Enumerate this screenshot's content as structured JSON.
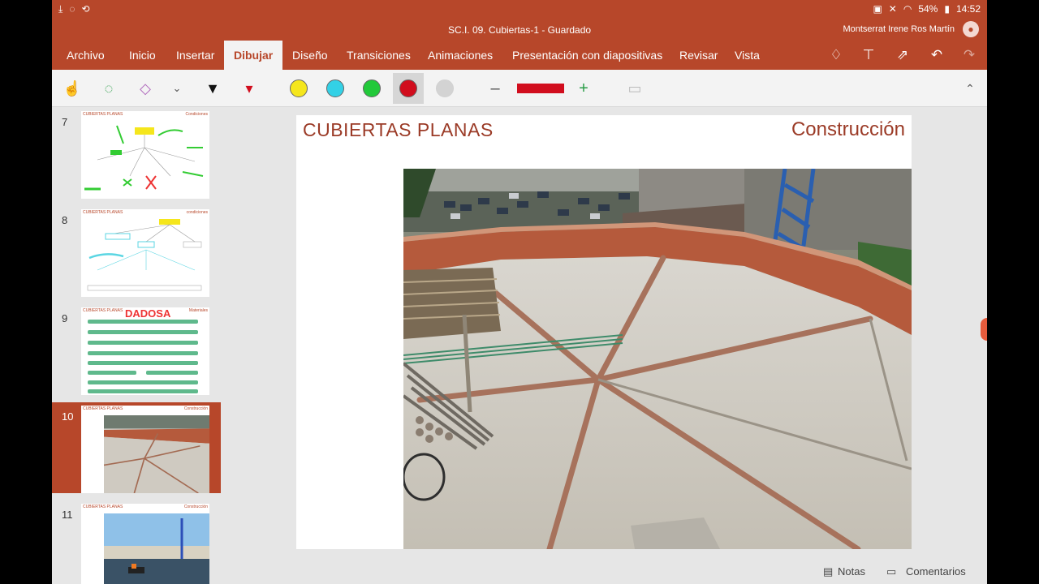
{
  "status": {
    "battery": "54%",
    "time": "14:52"
  },
  "window": {
    "title": "SC.I. 09. Cubiertas-1 - Guardado",
    "user": "Montserrat Irene Ros Martín"
  },
  "tabs": [
    {
      "label": "Archivo"
    },
    {
      "label": "Inicio"
    },
    {
      "label": "Insertar"
    },
    {
      "label": "Dibujar",
      "active": true
    },
    {
      "label": "Diseño"
    },
    {
      "label": "Transiciones"
    },
    {
      "label": "Animaciones"
    },
    {
      "label": "Presentación con diapositivas"
    },
    {
      "label": "Revisar"
    },
    {
      "label": "Vista"
    }
  ],
  "toolbar": {
    "icons": [
      "touch-draw-icon",
      "lasso-select-icon",
      "eraser-icon",
      "chevron-down-icon",
      "pen-icon",
      "highlighter-icon"
    ],
    "colors": [
      "#f5e61c",
      "#33d1e6",
      "#22c93a",
      "#d10d1d",
      "#bfbfbf"
    ],
    "selected_color": "#d10d1d",
    "stroke_minus": "–",
    "stroke_plus": "+"
  },
  "thumbnails": [
    {
      "number": "7",
      "header": "CUBIERTAS PLANAS",
      "tag": "Condiciones"
    },
    {
      "number": "8",
      "header": "CUBIERTAS PLANAS",
      "tag": "condiciones"
    },
    {
      "number": "9",
      "header": "CUBIERTAS PLANAS",
      "tag": "Materiales",
      "annotation": "DADOSA"
    },
    {
      "number": "10",
      "header": "CUBIERTAS PLANAS",
      "tag": "Construcción",
      "active": true
    },
    {
      "number": "11",
      "header": "CUBIERTAS PLANAS",
      "tag": "Construcción"
    }
  ],
  "slide": {
    "title": "CUBIERTAS PLANAS",
    "label": "Construcción"
  },
  "bottom": {
    "notes": "Notas",
    "comments": "Comentarios"
  }
}
